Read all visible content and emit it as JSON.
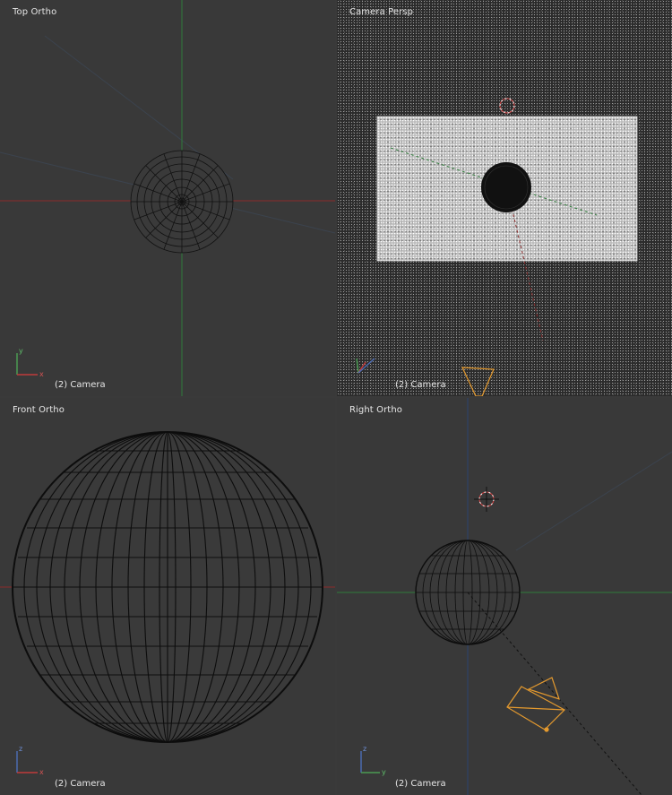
{
  "viewports": {
    "top": {
      "title": "Top Ortho",
      "footer": "(2) Camera",
      "axes": [
        "y",
        "x"
      ]
    },
    "camera": {
      "title": "Camera Persp",
      "footer": "(2) Camera"
    },
    "front": {
      "title": "Front Ortho",
      "footer": "(2) Camera",
      "axes": [
        "z",
        "x"
      ]
    },
    "right": {
      "title": "Right Ortho",
      "footer": "(2) Camera",
      "axes": [
        "z",
        "y"
      ]
    }
  },
  "colors": {
    "background": "#393939",
    "x_axis": "#8b2b2b",
    "y_axis": "#2f7a3a",
    "camera_object": "#e59a2e",
    "wire": "#000000"
  }
}
